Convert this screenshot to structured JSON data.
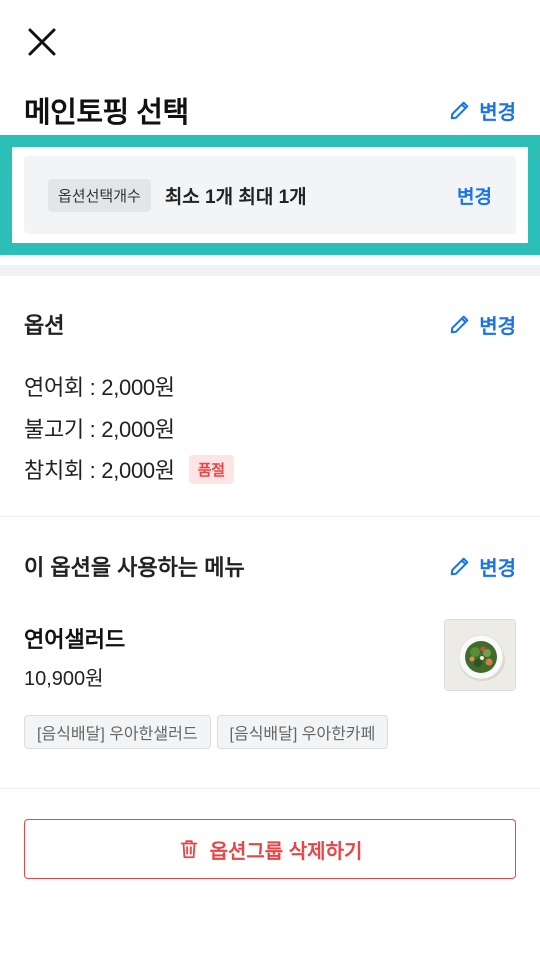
{
  "header": {
    "title": "메인토핑 선택",
    "change_label": "변경"
  },
  "option_count": {
    "tag": "옵션선택개수",
    "text": "최소 1개 최대 1개",
    "change_label": "변경"
  },
  "options_section": {
    "title": "옵션",
    "change_label": "변경",
    "items": [
      {
        "text": "연어회 : 2,000원",
        "badge": ""
      },
      {
        "text": "불고기 : 2,000원",
        "badge": ""
      },
      {
        "text": "참치회 : 2,000원",
        "badge": "품절"
      }
    ]
  },
  "menus_section": {
    "title": "이 옵션을 사용하는 메뉴",
    "change_label": "변경",
    "menu": {
      "name": "연어샐러드",
      "price": "10,900원",
      "stores": [
        "[음식배달] 우아한샐러드",
        "[음식배달] 우아한카페"
      ]
    }
  },
  "delete_button": {
    "label": "옵션그룹 삭제하기"
  },
  "colors": {
    "accent": "#1a73e8",
    "danger": "#e84545",
    "highlight": "#2cbfb7"
  }
}
